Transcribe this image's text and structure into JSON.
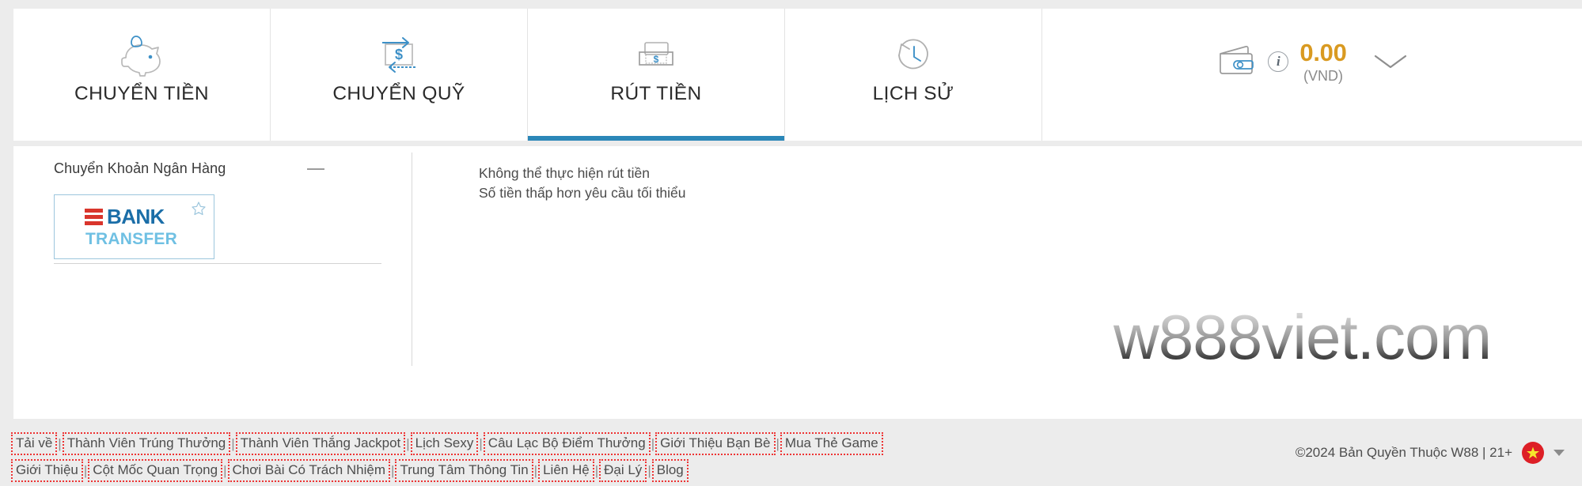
{
  "header": {
    "tabs": [
      {
        "label": "CHUYỂN TIỀN",
        "icon": "piggy-bank-icon",
        "active": false
      },
      {
        "label": "CHUYỂN QUỸ",
        "icon": "transfer-funds-icon",
        "active": false
      },
      {
        "label": "RÚT TIỀN",
        "icon": "withdraw-cash-icon",
        "active": true
      },
      {
        "label": "LỊCH SỬ",
        "icon": "history-clock-icon",
        "active": false
      }
    ],
    "wallet": {
      "icon": "wallet-icon",
      "info_icon": "info-icon",
      "balance": "0.00",
      "currency": "(VND)",
      "expand_icon": "chevron-down-icon",
      "balance_color": "#d99a21"
    },
    "active_underline_color": "#2b87b8"
  },
  "main": {
    "left_panel": {
      "title": "Chuyển Khoản Ngân Hàng",
      "collapse_icon": "minus-icon",
      "method": {
        "name": "bank-transfer-logo",
        "line1": "BANK",
        "line2": "TRANSFER",
        "favorite_icon": "star-outline-icon",
        "bar_color": "#d9352c",
        "word_color": "#1b6ea8",
        "word2_color": "#6fc0e3"
      }
    },
    "message": {
      "line1": "Không thể thực hiện rút tiền",
      "line2": "Số tiền thấp hơn yêu cầu tối thiểu"
    },
    "watermark": "w888viet.com"
  },
  "footer": {
    "links_row1": [
      "Tải về",
      "Thành Viên Trúng Thưởng",
      "Thành Viên Thắng Jackpot",
      "Lịch Sexy",
      "Câu Lạc Bộ Điểm Thưởng",
      "Giới Thiệu Bạn Bè",
      "Mua Thẻ Game"
    ],
    "links_row2": [
      "Giới Thiệu",
      "Cột Mốc Quan Trọng",
      "Chơi Bài Có Trách Nhiệm",
      "Trung Tâm Thông Tin",
      "Liên Hệ",
      "Đại Lý",
      "Blog"
    ],
    "separator": "|",
    "copyright": "©2024 Bản Quyền Thuộc W88 | 21+",
    "flag_icon": "vietnam-flag-icon",
    "language_caret_icon": "caret-down-icon",
    "link_border_color": "#ee3333"
  }
}
